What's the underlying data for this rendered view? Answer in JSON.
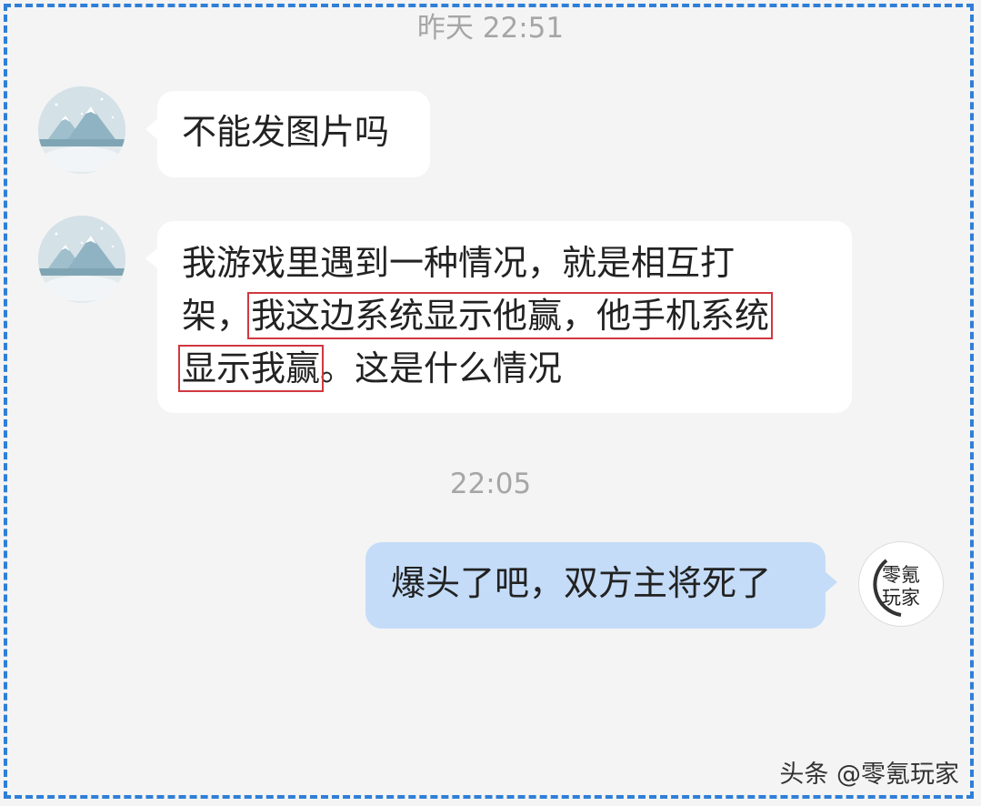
{
  "timestamps": [
    "昨天 22:51",
    "22:05"
  ],
  "messages": [
    {
      "side": "incoming",
      "lines": [
        "不能发图片吗"
      ]
    },
    {
      "side": "incoming",
      "line1": "我游戏里遇到一种情况，就是相互打",
      "line2_prefix": "架，",
      "line2_highlight": "我这边系统显示他赢，他手机系统",
      "line3_highlight": "显示我赢",
      "line3_suffix": "。这是什么情况"
    },
    {
      "side": "outgoing",
      "lines": [
        "爆头了吧，双方主将死了"
      ]
    }
  ],
  "self_avatar": {
    "line1": "零氪",
    "line2": "玩家"
  },
  "watermark": "头条 @零氪玩家",
  "colors": {
    "background": "#f4f4f4",
    "frame": "#2f7fd8",
    "outgoing_bubble": "#c4dcf8",
    "highlight": "#d0383f"
  },
  "icons": {
    "contact_avatar": "snowy-mountain-avatar-icon"
  }
}
